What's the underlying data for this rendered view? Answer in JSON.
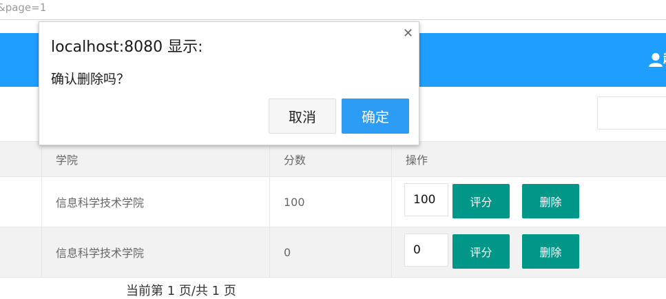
{
  "browser": {
    "url_fragment": "&page=1"
  },
  "header": {
    "user_icon": "user-icon",
    "user_text": "超"
  },
  "table": {
    "columns": [
      "学院",
      "分数",
      "操作"
    ],
    "rows": [
      {
        "college": "信息科学技术学院",
        "score": "100",
        "input_value": "100",
        "rate_label": "评分",
        "delete_label": "删除"
      },
      {
        "college": "信息科学技术学院",
        "score": "0",
        "input_value": "0",
        "rate_label": "评分",
        "delete_label": "删除"
      }
    ]
  },
  "pager": {
    "text": "当前第 1 页/共 1 页"
  },
  "dialog": {
    "title": "localhost:8080 显示:",
    "message": "确认删除吗？",
    "cancel_label": "取消",
    "ok_label": "确定",
    "close_icon": "close-icon"
  },
  "colors": {
    "header": "#1e9fff",
    "action_button": "#009688",
    "dialog_ok": "#2d9cf4"
  }
}
